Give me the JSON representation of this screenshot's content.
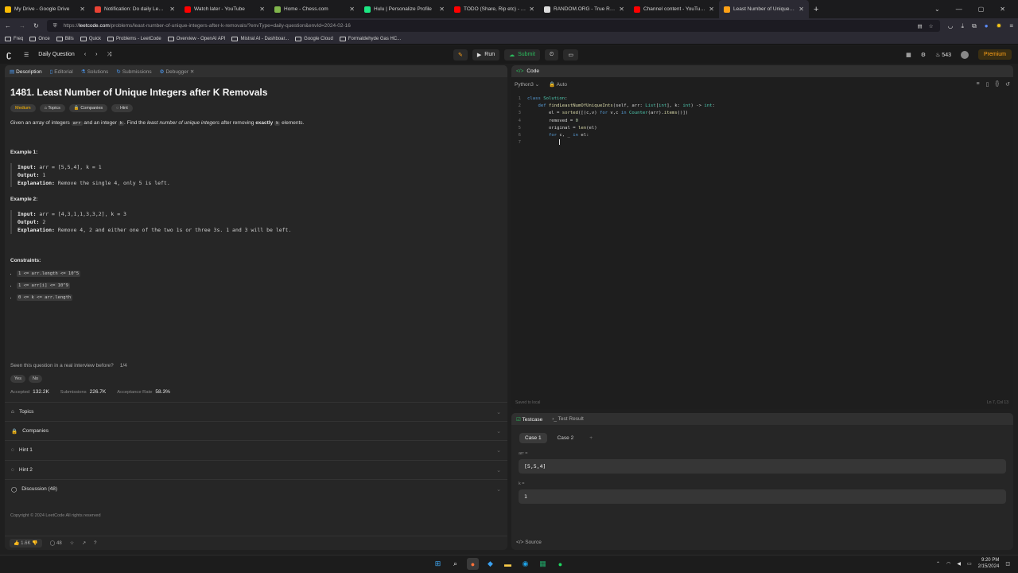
{
  "browser": {
    "tabs": [
      {
        "title": "My Drive - Google Drive",
        "color": "#fbbc04"
      },
      {
        "title": "Notification: Do daily Leetcode",
        "color": "#ea4335"
      },
      {
        "title": "Watch later - YouTube",
        "color": "#ff0000"
      },
      {
        "title": "Home - Chess.com",
        "color": "#81b64c"
      },
      {
        "title": "Hulu | Personalize Profile",
        "color": "#1ce783"
      },
      {
        "title": "TODO (Share, Rip etc) - YouTube",
        "color": "#ff0000"
      },
      {
        "title": "RANDOM.ORG - True Random",
        "color": "#dddddd"
      },
      {
        "title": "Channel content - YouTube Stu",
        "color": "#ff0000"
      },
      {
        "title": "Least Number of Unique Intege",
        "color": "#ffa116"
      }
    ],
    "url_prefix": "https://",
    "url_domain": "leetcode.com",
    "url_path": "/problems/least-number-of-unique-integers-after-k-removals/?envType=daily-question&envId=2024-02-16",
    "bookmarks": [
      "Freq",
      "Once",
      "Bills",
      "Quick",
      "Problems - LeetCode",
      "Overview - OpenAI API",
      "Mistral AI - Dashboar...",
      "Google Cloud",
      "Formaldehyde Gas HC..."
    ]
  },
  "lc_header": {
    "daily": "Daily Question",
    "run": "Run",
    "submit": "Submit",
    "streak": "543",
    "premium": "Premium"
  },
  "left_tabs": [
    "Description",
    "Editorial",
    "Solutions",
    "Submissions",
    "Debugger"
  ],
  "problem": {
    "title": "1481. Least Number of Unique Integers after K Removals",
    "difficulty": "Medium",
    "tags": [
      "Topics",
      "Companies",
      "Hint"
    ],
    "desc_a": "Given an array of integers ",
    "desc_code1": "arr",
    "desc_b": " and an integer ",
    "desc_code2": "k",
    "desc_c": ". Find the ",
    "desc_em": "least number of unique integers",
    "desc_d": " after removing ",
    "desc_bold": "exactly",
    "desc_code3": "k",
    "desc_e": " elements.",
    "example1_title": "Example 1:",
    "example1": {
      "input_label": "Input:",
      "input": " arr = [5,5,4], k = 1",
      "output_label": "Output:",
      "output": " 1",
      "expl_label": "Explanation:",
      "expl": " Remove the single 4, only 5 is left."
    },
    "example2_title": "Example 2:",
    "example2": {
      "input_label": "Input:",
      "input": " arr = [4,3,1,1,3,3,2], k = 3",
      "output_label": "Output:",
      "output": " 2",
      "expl_label": "Explanation:",
      "expl": " Remove 4, 2 and either one of the two 1s or three 3s. 1 and 3 will be left."
    },
    "constraints_title": "Constraints:",
    "constraints": [
      "1 <= arr.length <= 10^5",
      "1 <= arr[i] <= 10^9",
      "0 <= k <= arr.length"
    ],
    "seen": "Seen this question in a real interview before?",
    "seen_count": "1/4",
    "yes": "Yes",
    "no": "No",
    "accepted_label": "Accepted",
    "accepted": "132.2K",
    "submissions_label": "Submissions",
    "submissions": "226.7K",
    "rate_label": "Acceptance Rate",
    "rate": "58.3%",
    "sections": [
      "Topics",
      "Companies",
      "Hint 1",
      "Hint 2",
      "Discussion (48)"
    ],
    "copyright": "Copyright © 2024 LeetCode All rights reserved",
    "likes": "1.6K",
    "comments": "48"
  },
  "code_panel": {
    "title": "Code",
    "language": "Python3",
    "auto": "Auto",
    "saved": "Saved to local",
    "cursor_pos": "Ln 7, Col 13"
  },
  "code_lines": [
    {
      "n": "1",
      "t": "class Solution:"
    },
    {
      "n": "2",
      "t": "    def findLeastNumOfUniqueInts(self, arr: List[int], k: int) -> int:"
    },
    {
      "n": "3",
      "t": "        el = sorted([(c,v) for v,c in Counter(arr).items()])"
    },
    {
      "n": "4",
      "t": "        removed = 0"
    },
    {
      "n": "5",
      "t": "        original = len(el)"
    },
    {
      "n": "6",
      "t": "        for c, _ in el:"
    },
    {
      "n": "7",
      "t": "            "
    }
  ],
  "testcase": {
    "tab1": "Testcase",
    "tab2": "Test Result",
    "cases": [
      "Case 1",
      "Case 2"
    ],
    "arr_label": "arr =",
    "arr_value": "[5,5,4]",
    "k_label": "k =",
    "k_value": "1",
    "source": "Source"
  },
  "taskbar": {
    "time": "9:20 PM",
    "date": "2/15/2024"
  }
}
